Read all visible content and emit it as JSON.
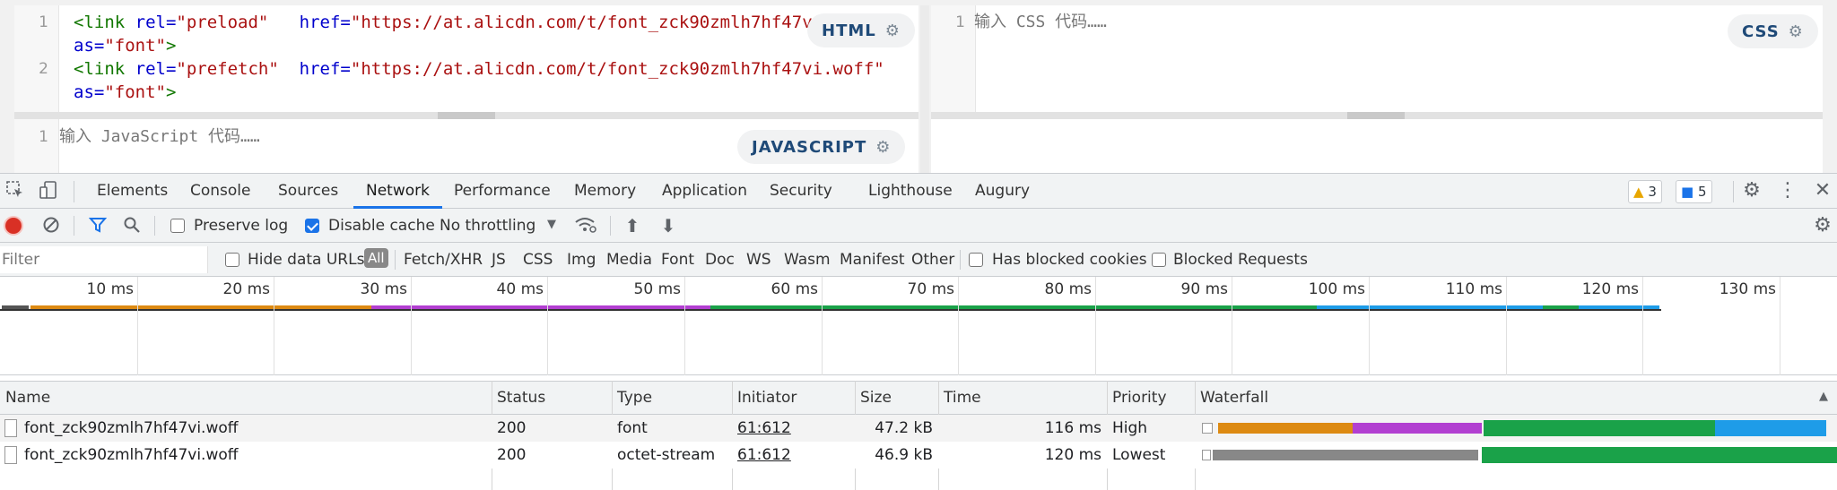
{
  "editors": {
    "html": {
      "badge": "HTML",
      "line_numbers": [
        "1",
        "2"
      ],
      "lines": [
        {
          "open": "<link",
          "rel_attr": " rel=",
          "rel_val": "\"preload\"",
          "href_attr": "   href=",
          "href_val": "\"https://at.alicdn.com/t/font_zck90zmlh7hf47vi.woff\"",
          "as_attr": "as=",
          "as_val": "\"font\"",
          "close": ">"
        },
        {
          "open": "<link",
          "rel_attr": " rel=",
          "rel_val": "\"prefetch\"",
          "href_attr": "  href=",
          "href_val": "\"https://at.alicdn.com/t/font_zck90zmlh7hf47vi.woff\"",
          "as_attr": "as=",
          "as_val": "\"font\"",
          "close": ">"
        }
      ]
    },
    "css": {
      "badge": "CSS",
      "line_number": "1",
      "placeholder": "输入 CSS 代码……"
    },
    "js": {
      "badge": "JAVASCRIPT",
      "line_number": "1",
      "placeholder": "输入 JavaScript 代码……"
    }
  },
  "devtools": {
    "tabs": [
      "Elements",
      "Console",
      "Sources",
      "Network",
      "Performance",
      "Memory",
      "Application",
      "Security",
      "Lighthouse",
      "Augury"
    ],
    "active_tab": "Network",
    "warnings_count": "3",
    "messages_count": "5",
    "toolbar": {
      "preserve_log": "Preserve log",
      "disable_cache": "Disable cache",
      "throttling": "No throttling"
    },
    "filter": {
      "placeholder": "Filter",
      "hide_data_urls": "Hide data URLs",
      "types": [
        "All",
        "Fetch/XHR",
        "JS",
        "CSS",
        "Img",
        "Media",
        "Font",
        "Doc",
        "WS",
        "Wasm",
        "Manifest",
        "Other"
      ],
      "has_blocked_cookies": "Has blocked cookies",
      "blocked_requests": "Blocked Requests"
    },
    "timeline_labels": [
      "10 ms",
      "20 ms",
      "30 ms",
      "40 ms",
      "50 ms",
      "60 ms",
      "70 ms",
      "80 ms",
      "90 ms",
      "100 ms",
      "110 ms",
      "120 ms",
      "130 ms"
    ],
    "table": {
      "columns": [
        "Name",
        "Status",
        "Type",
        "Initiator",
        "Size",
        "Time",
        "Priority",
        "Waterfall"
      ],
      "rows": [
        {
          "name": "font_zck90zmlh7hf47vi.woff",
          "status": "200",
          "type": "font",
          "initiator": "61:612",
          "size": "47.2 kB",
          "time": "116 ms",
          "priority": "High"
        },
        {
          "name": "font_zck90zmlh7hf47vi.woff",
          "status": "200",
          "type": "octet-stream",
          "initiator": "61:612",
          "size": "46.9 kB",
          "time": "120 ms",
          "priority": "Lowest"
        }
      ]
    },
    "colors": {
      "queue": "#dd8a12",
      "ssl": "#b23fd1",
      "waiting": "#1aa249",
      "download": "#1e9ce8",
      "stalled": "#888888",
      "accent": "#1a73e8"
    }
  }
}
